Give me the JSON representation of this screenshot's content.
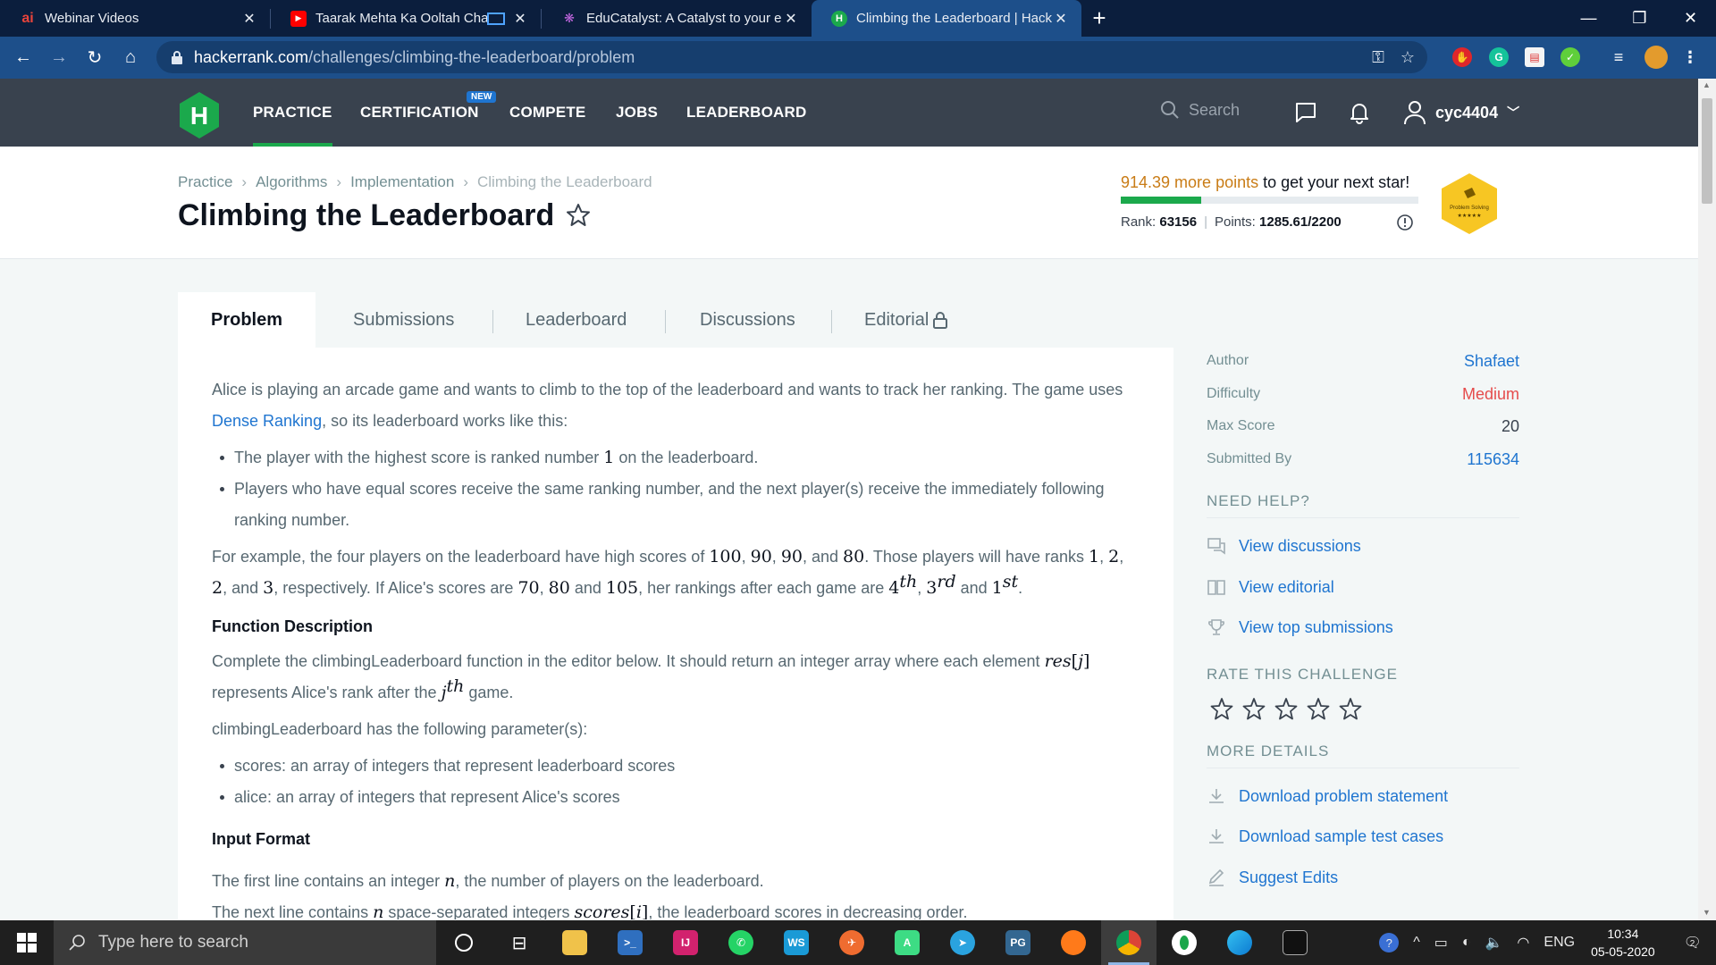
{
  "browser": {
    "tabs": [
      {
        "title": "Webinar Videos",
        "icon": "ai-favicon",
        "color": "#e8443b",
        "glyph": "ai"
      },
      {
        "title": "Taarak Mehta Ka Ooltah Cha",
        "icon": "youtube-favicon",
        "color": "#ff0000",
        "glyph": "▶"
      },
      {
        "title": "EduCatalyst: A Catalyst to your e",
        "icon": "educatalyst-favicon",
        "color": "#b44fd1",
        "glyph": "❋"
      },
      {
        "title": "Climbing the Leaderboard | Hack",
        "icon": "hackerrank-favicon",
        "color": "#1ba94c",
        "glyph": "H",
        "active": true
      }
    ],
    "url_host": "hackerrank.com",
    "url_path": "/challenges/climbing-the-leaderboard/problem"
  },
  "nav": {
    "links": [
      "PRACTICE",
      "CERTIFICATION",
      "COMPETE",
      "JOBS",
      "LEADERBOARD"
    ],
    "new_badge": "NEW",
    "search_placeholder": "Search",
    "username": "cyc4404"
  },
  "header": {
    "breadcrumb": [
      "Practice",
      "Algorithms",
      "Implementation",
      "Climbing the Leaderboard"
    ],
    "title": "Climbing the Leaderboard",
    "points_needed": "914.39 more points",
    "points_suffix": " to get your next star!",
    "progress_fraction": 0.27,
    "rank_label": "Rank:",
    "rank_value": "63156",
    "points_label": "Points:",
    "points_value": "1285.61/2200",
    "badge_text": "Problem Solving",
    "badge_stars": "★★★★★"
  },
  "tabs": [
    "Problem",
    "Submissions",
    "Leaderboard",
    "Discussions",
    "Editorial"
  ],
  "problem": {
    "intro_1": "Alice is playing an arcade game and wants to climb to the top of the leaderboard and wants to track her ranking. The game uses ",
    "intro_link": "Dense Ranking",
    "intro_2": ", so its leaderboard works like this:",
    "bullet_1a": "The player with the highest score is ranked number ",
    "bullet_1_num": "1",
    "bullet_1b": " on the leaderboard.",
    "bullet_2": "Players who have equal scores receive the same ranking number, and the next player(s) receive the immediately following ranking number.",
    "example_a": "For example, the four players on the leaderboard have high scores of ",
    "example_scores": [
      "100",
      "90",
      "90",
      "80"
    ],
    "example_b": ". Those players will have ranks ",
    "example_ranks": [
      "1",
      "2",
      "2",
      "3"
    ],
    "example_c": ", respectively. If Alice's scores are ",
    "alice_scores": [
      "70",
      "80",
      "105"
    ],
    "example_d": ", her rankings after each game are ",
    "alice_ranks": [
      {
        "n": "4",
        "s": "th"
      },
      {
        "n": "3",
        "s": "rd"
      },
      {
        "n": "1",
        "s": "st"
      }
    ],
    "fd_heading": "Function Description",
    "fd_1": "Complete the climbingLeaderboard function in the editor below. It should return an integer array where each element ",
    "fd_res": "res",
    "fd_j": "j",
    "fd_2": " represents Alice's rank after the ",
    "fd_jth_sup": "th",
    "fd_3": " game.",
    "params_intro": "climbingLeaderboard has the following parameter(s):",
    "param_1": "scores: an array of integers that represent leaderboard scores",
    "param_2": "alice: an array of integers that represent Alice's scores",
    "if_heading": "Input Format",
    "if_1a": "The first line contains an integer ",
    "if_n": "n",
    "if_1b": ", the number of players on the leaderboard.",
    "if_2a": "The next line contains ",
    "if_2b": " space-separated integers ",
    "if_scores": "scores",
    "if_i": "i",
    "if_2c": ", the leaderboard scores in decreasing order."
  },
  "sidebar": {
    "meta": [
      {
        "key": "Author",
        "value": "Shafaet",
        "style": "link"
      },
      {
        "key": "Difficulty",
        "value": "Medium",
        "style": "medium"
      },
      {
        "key": "Max Score",
        "value": "20",
        "style": "plain"
      },
      {
        "key": "Submitted By",
        "value": "115634",
        "style": "link"
      }
    ],
    "need_help": "NEED HELP?",
    "help_links": [
      "View discussions",
      "View editorial",
      "View top submissions"
    ],
    "rate": "RATE THIS CHALLENGE",
    "more": "MORE DETAILS",
    "more_links": [
      "Download problem statement",
      "Download sample test cases",
      "Suggest Edits"
    ]
  },
  "taskbar": {
    "search_placeholder": "Type here to search",
    "lang": "ENG",
    "time": "10:34",
    "date": "05-05-2020",
    "notif_count": "2"
  },
  "colors": {
    "hr_green": "#1ba94c",
    "link_blue": "#1f75d0",
    "nav_dark": "#39424e"
  }
}
